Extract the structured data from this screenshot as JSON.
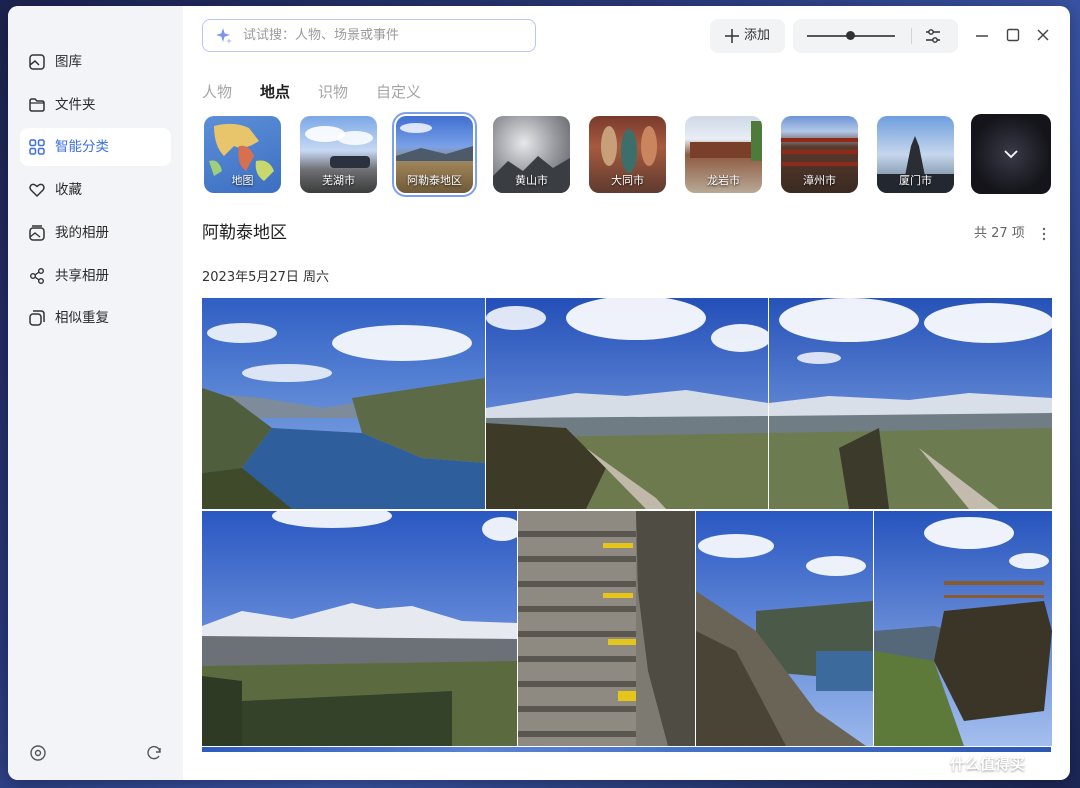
{
  "sidebar": {
    "items": [
      {
        "label": "图库",
        "icon": "gallery-icon"
      },
      {
        "label": "文件夹",
        "icon": "folder-icon"
      },
      {
        "label": "智能分类",
        "icon": "grid-icon",
        "active": true
      },
      {
        "label": "收藏",
        "icon": "heart-icon"
      },
      {
        "label": "我的相册",
        "icon": "album-icon"
      },
      {
        "label": "共享相册",
        "icon": "share-icon"
      },
      {
        "label": "相似重复",
        "icon": "duplicate-icon"
      }
    ],
    "bottom_icons": [
      "settings-icon",
      "sync-icon"
    ]
  },
  "search": {
    "placeholder": "试试搜：人物、场景或事件"
  },
  "toolbar": {
    "add_label": "添加"
  },
  "tabs": [
    {
      "label": "人物"
    },
    {
      "label": "地点",
      "active": true
    },
    {
      "label": "识物"
    },
    {
      "label": "自定义"
    }
  ],
  "places": [
    {
      "label": "地图"
    },
    {
      "label": "芜湖市"
    },
    {
      "label": "阿勒泰地区",
      "selected": true
    },
    {
      "label": "黄山市"
    },
    {
      "label": "大同市"
    },
    {
      "label": "龙岩市"
    },
    {
      "label": "漳州市"
    },
    {
      "label": "厦门市"
    }
  ],
  "section": {
    "title": "阿勒泰地区",
    "count": "共 27 项",
    "date": "2023年5月27日 周六"
  },
  "colors": {
    "accent": "#3d6fe0",
    "sidebar_bg": "#f3f4f8"
  },
  "watermark": "什么值得买"
}
